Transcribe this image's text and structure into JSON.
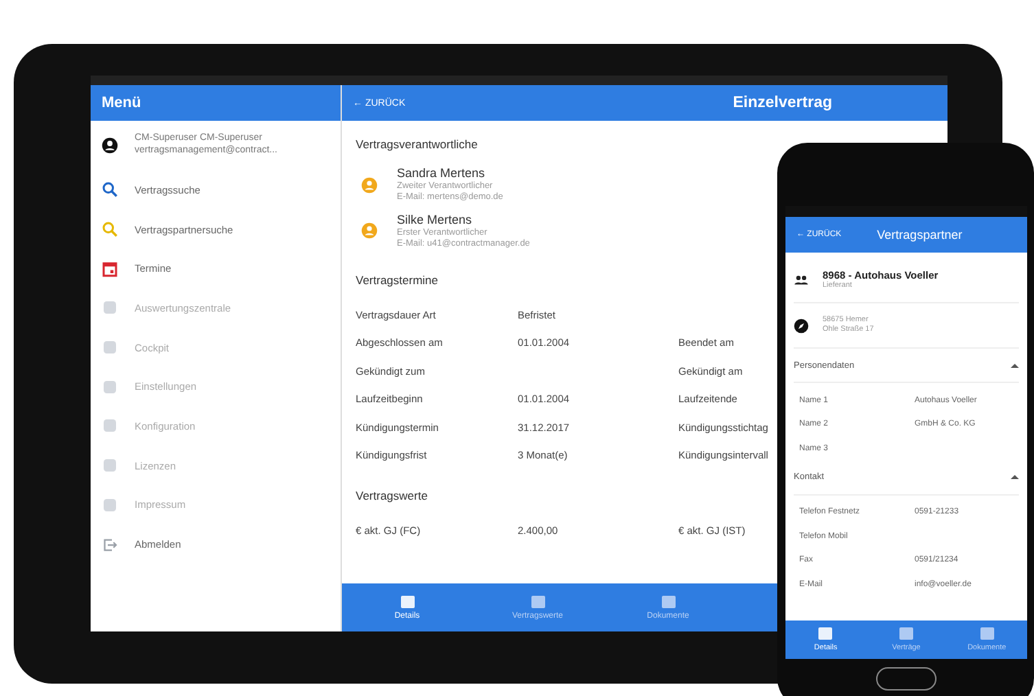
{
  "menu": {
    "title": "Menü",
    "user": {
      "name": "CM-Superuser CM-Superuser",
      "email": "vertragsmanagement@contract..."
    },
    "items": [
      {
        "label": "Vertragssuche",
        "disabled": false
      },
      {
        "label": "Vertragspartnersuche",
        "disabled": false
      },
      {
        "label": "Termine",
        "disabled": false
      },
      {
        "label": "Auswertungszentrale",
        "disabled": true
      },
      {
        "label": "Cockpit",
        "disabled": true
      },
      {
        "label": "Einstellungen",
        "disabled": true
      },
      {
        "label": "Konfiguration",
        "disabled": true
      },
      {
        "label": "Lizenzen",
        "disabled": true
      },
      {
        "label": "Impressum",
        "disabled": true
      },
      {
        "label": "Abmelden",
        "disabled": false
      }
    ]
  },
  "contract": {
    "back": "← ZURÜCK",
    "title": "Einzelvertrag",
    "responsible_heading": "Vertragsverantwortliche",
    "persons": [
      {
        "name": "Sandra Mertens",
        "role": "Zweiter Verantwortlicher",
        "email": "E-Mail: mertens@demo.de"
      },
      {
        "name": "Silke Mertens",
        "role": "Erster Verantwortlicher",
        "email": "E-Mail: u41@contractmanager.de"
      }
    ],
    "dates_heading": "Vertragstermine",
    "dates": [
      {
        "label": "Vertragsdauer Art",
        "value": "Befristet"
      },
      {
        "label": "Abgeschlossen am",
        "value": "01.01.2004",
        "label_2": "Beendet am"
      },
      {
        "label": "Gekündigt zum",
        "label_2": "Gekündigt am"
      },
      {
        "label": "Laufzeitbeginn",
        "value": "01.01.2004",
        "label_2": "Laufzeitende"
      },
      {
        "label": "Kündigungstermin",
        "value": "31.12.2017",
        "label_2": "Kündigungsstichtag"
      },
      {
        "label": "Kündigungsfrist",
        "value": "3 Monat(e)",
        "label_2": "Kündigungsintervall"
      }
    ],
    "values_heading": "Vertragswerte",
    "values": [
      {
        "label": "€ akt. GJ (FC)",
        "value": "2.400,00",
        "label_2": "€ akt. GJ (IST)"
      }
    ],
    "tabs": [
      {
        "label": "Details",
        "selected": true
      },
      {
        "label": "Vertragswerte",
        "selected": false
      },
      {
        "label": "Dokumente",
        "selected": false
      }
    ]
  },
  "phone": {
    "back": "← ZURÜCK",
    "title": "Vertragspartner",
    "partner": {
      "name": "8968 - Autohaus Voeller",
      "type": "Lieferant",
      "city": "58675 Hemer",
      "street": "Ohle Straße 17"
    },
    "sections": [
      {
        "title": "Personendaten",
        "expanded": true,
        "rows": [
          {
            "label": "Name 1",
            "value": "Autohaus Voeller"
          },
          {
            "label": "Name 2",
            "value": "GmbH & Co. KG"
          },
          {
            "label": "Name 3"
          }
        ]
      },
      {
        "title": "Kontakt",
        "expanded": true,
        "rows": [
          {
            "label": "Telefon Festnetz",
            "value": "0591-21233"
          },
          {
            "label": "Telefon Mobil"
          },
          {
            "label": "Fax",
            "value": "0591/21234"
          },
          {
            "label": "E-Mail",
            "value": "info@voeller.de"
          }
        ]
      }
    ],
    "tabs": [
      {
        "label": "Details",
        "selected": true
      },
      {
        "label": "Verträge",
        "selected": false
      },
      {
        "label": "Dokumente",
        "selected": false
      }
    ]
  }
}
